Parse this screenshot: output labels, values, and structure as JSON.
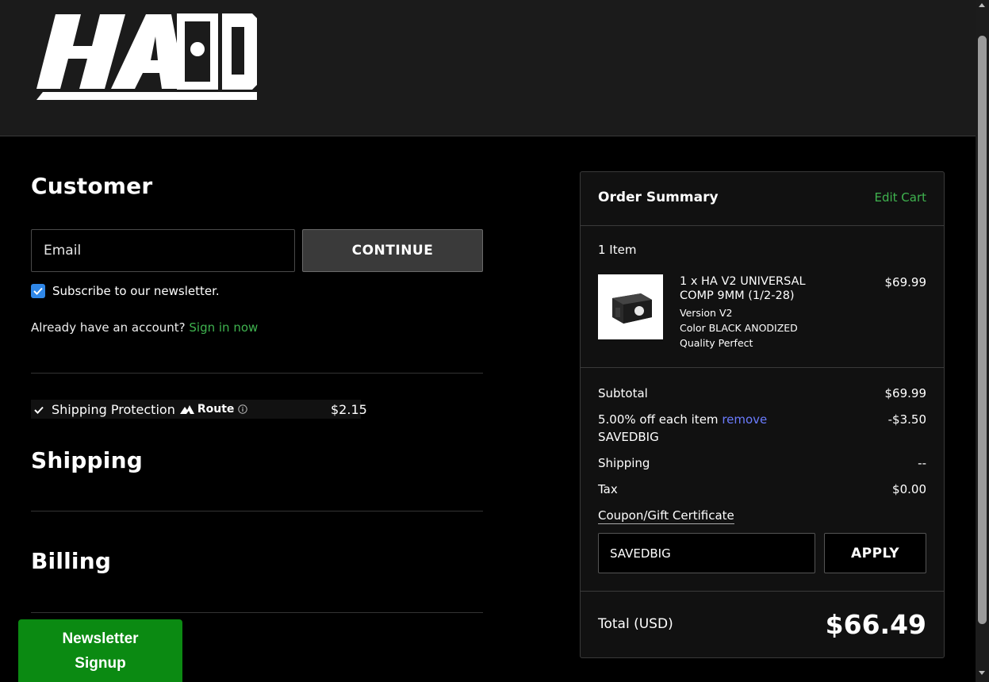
{
  "brand": {
    "logo_text": "HA"
  },
  "customer": {
    "title": "Customer",
    "email_placeholder": "Email",
    "continue_label": "CONTINUE",
    "newsletter_label": "Subscribe to our newsletter.",
    "account_prompt": "Already have an account?",
    "sign_in_label": "Sign in now"
  },
  "shipping_protection": {
    "label": "Shipping Protection",
    "provider": "Route",
    "price": "$2.15"
  },
  "shipping": {
    "title": "Shipping"
  },
  "billing": {
    "title": "Billing"
  },
  "newsletter_widget": {
    "label": "Newsletter Signup"
  },
  "order_summary": {
    "title": "Order Summary",
    "edit_cart_label": "Edit Cart",
    "item_count": "1 Item",
    "item": {
      "name": "1 x HA V2 UNIVERSAL COMP 9MM (1/2-28)",
      "price": "$69.99",
      "options": [
        "Version V2",
        "Color BLACK ANODIZED",
        "Quality Perfect"
      ]
    },
    "subtotal_label": "Subtotal",
    "subtotal_value": "$69.99",
    "discount_label": "5.00% off each item",
    "discount_remove": "remove",
    "discount_code": "SAVEDBIG",
    "discount_value": "-$3.50",
    "shipping_label": "Shipping",
    "shipping_value": "--",
    "tax_label": "Tax",
    "tax_value": "$0.00",
    "coupon_label": "Coupon/Gift Certificate",
    "coupon_value": "SAVEDBIG",
    "apply_label": "APPLY",
    "total_label": "Total (USD)",
    "total_value": "$66.49"
  },
  "colors": {
    "accent_green": "#3fb34f",
    "checkbox_blue": "#2f87e8",
    "link_blue": "#6b7cff",
    "widget_green": "#0b8a12"
  }
}
